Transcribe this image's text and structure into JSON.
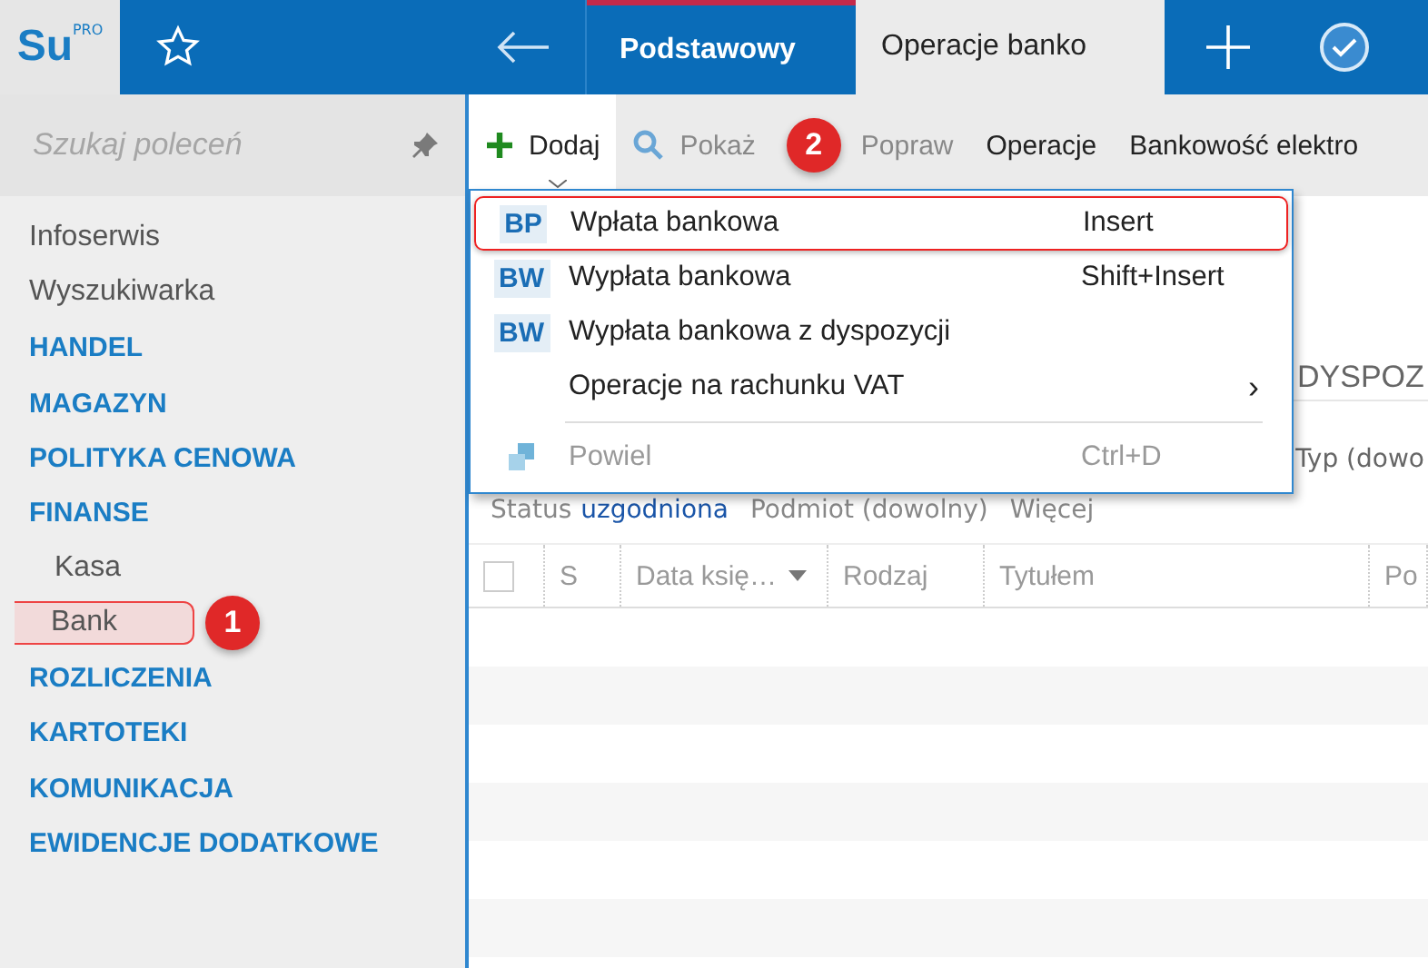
{
  "topbar": {
    "logo": "Su",
    "logo_sup": "PRO",
    "tabs": [
      {
        "label": "Podstawowy",
        "selected": false
      },
      {
        "label": "Operacje banko",
        "selected": true
      }
    ]
  },
  "sidebar": {
    "search": {
      "placeholder": "Szukaj poleceń"
    },
    "items": [
      {
        "label": "Infoserwis",
        "kind": "link",
        "selected": false
      },
      {
        "label": "Wyszukiwarka",
        "kind": "link",
        "selected": false
      },
      {
        "label": "HANDEL",
        "kind": "section",
        "selected": false
      },
      {
        "label": "MAGAZYN",
        "kind": "section",
        "selected": false
      },
      {
        "label": "POLITYKA CENOWA",
        "kind": "section",
        "selected": false
      },
      {
        "label": "FINANSE",
        "kind": "section",
        "selected": false
      },
      {
        "label": "Kasa",
        "kind": "sub",
        "selected": false
      },
      {
        "label": "Bank",
        "kind": "sub",
        "selected": true,
        "badge": "1"
      },
      {
        "label": "ROZLICZENIA",
        "kind": "section",
        "selected": false
      },
      {
        "label": "KARTOTEKI",
        "kind": "section",
        "selected": false
      },
      {
        "label": "KOMUNIKACJA",
        "kind": "section",
        "selected": false
      },
      {
        "label": "EWIDENCJE DODATKOWE",
        "kind": "section",
        "selected": false
      }
    ]
  },
  "toolbar": {
    "buttons": [
      {
        "label": "Dodaj",
        "kind": "add",
        "selected": true
      },
      {
        "label": "Pokaż",
        "kind": "show",
        "selected": false
      },
      {
        "label": "Popraw",
        "kind": "edit",
        "selected": false
      },
      {
        "label": "Operacje",
        "kind": "plain",
        "selected": false
      },
      {
        "label": "Bankowość elektro",
        "kind": "plain",
        "selected": false
      }
    ],
    "badge": "2"
  },
  "menu": {
    "items": [
      {
        "kind": "doc",
        "code": "BP",
        "label": "Wpłata bankowa",
        "shortcut": "Insert",
        "highlighted": true
      },
      {
        "kind": "doc",
        "code": "BW",
        "label": "Wypłata bankowa",
        "shortcut": "Shift+Insert",
        "highlighted": false
      },
      {
        "kind": "doc",
        "code": "BW",
        "label": "Wypłata bankowa z dyspozycji",
        "highlighted": false
      },
      {
        "kind": "submenu",
        "label": "Operacje na rachunku VAT",
        "arrow": "›",
        "highlighted": false
      },
      {
        "kind": "separator"
      },
      {
        "kind": "copy",
        "label": "Powiel",
        "shortcut": "Ctrl+D",
        "highlighted": false
      }
    ]
  },
  "content": {
    "tab_label": "DYSPOZ",
    "filter_right": "Typ (dowo",
    "filters": [
      {
        "label": "Status",
        "value": "uzgodniona"
      },
      {
        "label": "Podmiot (dowolny)"
      },
      {
        "label": "Więcej"
      }
    ],
    "table": {
      "select_all_checked": false,
      "columns": [
        "S",
        "Data księ…",
        "Rodzaj",
        "Tytułem",
        "Po"
      ]
    }
  }
}
